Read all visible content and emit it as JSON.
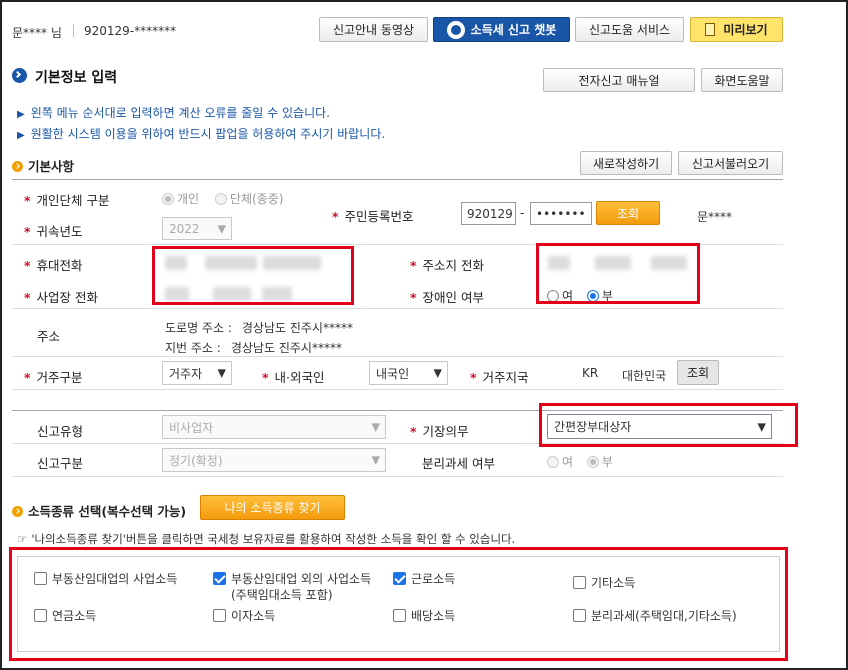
{
  "header": {
    "user_name": "문**** 님",
    "user_id": "920129-*******",
    "buttons": {
      "guide_video": "신고안내 동영상",
      "chatbot": "소득세 신고 챗봇",
      "help_service": "신고도움 서비스",
      "preview": "미리보기"
    }
  },
  "page": {
    "title": "기본정보 입력",
    "manual_button": "전자신고 매뉴얼",
    "screen_help_button": "화면도움말",
    "notices": [
      "왼쪽 메뉴 순서대로 입력하면 계산 오류를 줄일 수 있습니다.",
      "원활한 시스템 이용을 위하여 반드시 팝업을 허용하여 주시기 바랍니다."
    ]
  },
  "basic": {
    "section_title": "기본사항",
    "new_button": "새로작성하기",
    "load_button": "신고서불러오기",
    "person_type_label": "개인단체 구분",
    "person_type_options": [
      "개인",
      "단체(종중)"
    ],
    "year_label": "귀속년도",
    "year_value": "2022",
    "rrn_label": "주민등록번호",
    "rrn_front": "920129",
    "rrn_dash": "-",
    "rrn_back": "•••••••",
    "rrn_search_button": "조회",
    "rrn_name": "문****",
    "mobile_label": "휴대전화",
    "home_phone_label": "주소지 전화",
    "work_phone_label": "사업장 전화",
    "disabled_label": "장애인 여부",
    "disabled_options": [
      "여",
      "부"
    ],
    "address_label": "주소",
    "road_address_label": "도로명 주소 :",
    "road_address_value": "경상남도 진주시*****",
    "lot_address_label": "지번 주소 :",
    "lot_address_value": "경상남도 진주시*****",
    "residence_label": "거주구분",
    "residence_value": "거주자",
    "nationality_label": "내·외국인",
    "nationality_value": "내국인",
    "country_label": "거주지국",
    "country_code": "KR",
    "country_name": "대한민국",
    "country_search_button": "조회"
  },
  "report": {
    "type_label": "신고유형",
    "type_value": "비사업자",
    "bookkeeping_label": "기장의무",
    "bookkeeping_value": "간편장부대상자",
    "category_label": "신고구분",
    "category_value": "정기(확정)",
    "separate_tax_label": "분리과세 여부",
    "separate_tax_options": [
      "여",
      "부"
    ]
  },
  "income": {
    "section_title": "소득종류 선택(복수선택 가능)",
    "find_button": "나의 소득종류 찾기",
    "hint": "'나의소득종류 찾기'버튼을 클릭하면 국세청 보유자료를 활용하여 작성한 소득을 확인 할 수 있습니다.",
    "items": [
      {
        "label": "부동산임대업의 사업소득",
        "checked": false
      },
      {
        "label": "부동산임대업 외의 사업소득",
        "sub": "(주택임대소득 포함)",
        "checked": true
      },
      {
        "label": "근로소득",
        "checked": true
      },
      {
        "label": "기타소득",
        "checked": false
      },
      {
        "label": "연금소득",
        "checked": false
      },
      {
        "label": "이자소득",
        "checked": false
      },
      {
        "label": "배당소득",
        "checked": false
      },
      {
        "label": "분리과세(주택임대,기타소득)",
        "checked": false
      }
    ]
  },
  "colors": {
    "accent_blue": "#1a56a8",
    "highlight_red": "#e3001b",
    "orange": "#f39b0b"
  }
}
